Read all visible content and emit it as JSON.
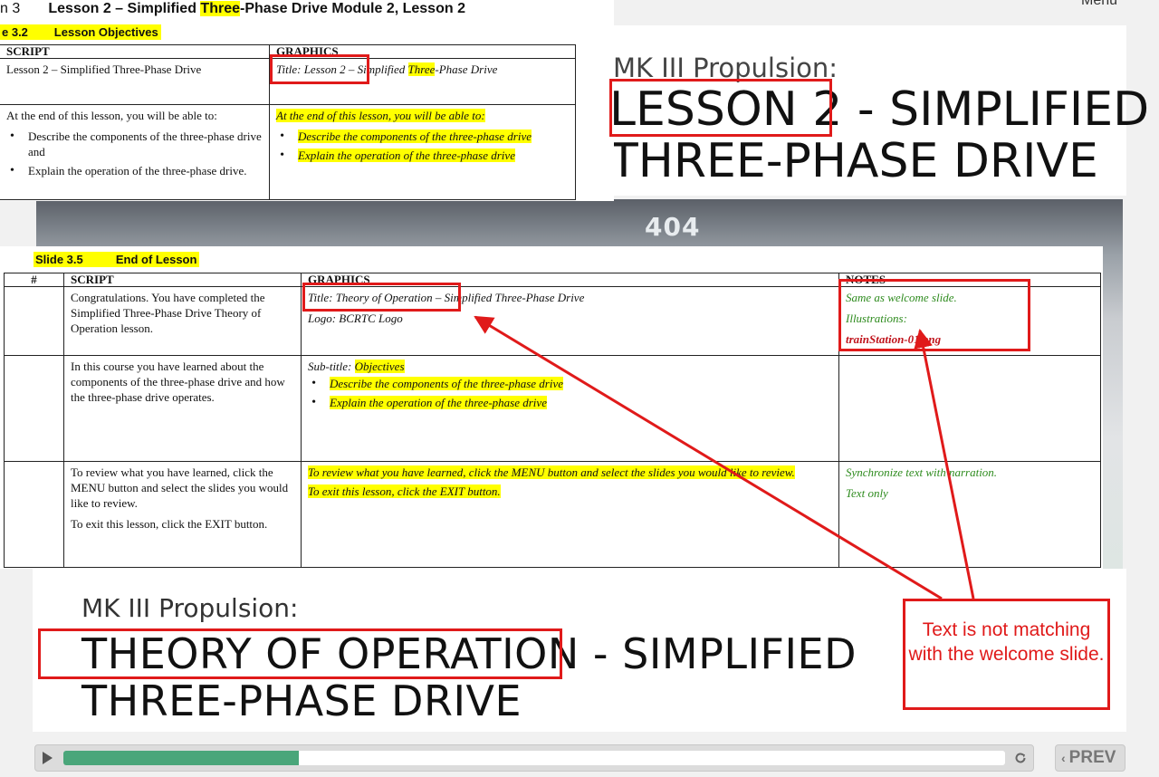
{
  "player": {
    "menu_label": "Menu",
    "train_number": "404",
    "bottom_slide": {
      "subtitle": "MK III Propulsion:",
      "title_boxed": "THEORY OF OPERATION",
      "title_rest": " - SIMPLIFIED",
      "title_line2": "THREE-PHASE DRIVE"
    },
    "top_slide": {
      "subtitle": "MK III Propulsion:",
      "title_boxed": "LESSON 2",
      "title_rest": " - SIMPLIFIED",
      "title_line2": "THREE-PHASE DRIVE"
    },
    "progress": 0.25,
    "prev_label": "PREV",
    "colors": {
      "progress": "#4aa67a",
      "annotation": "#e01a1a",
      "highlight": "#ffff00",
      "note_green": "#2e8b1e"
    }
  },
  "doc1": {
    "heading_num": "n 3",
    "heading_pre": "Lesson 2 – Simplified ",
    "heading_hl": "Three",
    "heading_post": "-Phase Drive Module 2, Lesson 2",
    "slide_label": "e 3.2        Lesson Objectives",
    "col_script": "SCRIPT",
    "col_graphics": "GRAPHICS",
    "row1_script": "Lesson 2 – Simplified Three-Phase Drive",
    "row1_graphics_boxed": "Title: Lesson 2 –",
    "row1_graphics_mid": " Simplified ",
    "row1_graphics_hl": "Three",
    "row1_graphics_post": "-Phase Drive",
    "row2_script_intro": "At the end of this lesson, you will be able to:",
    "row2_script_items": [
      "Describe the components of the three-phase drive and",
      "Explain the operation of the three-phase drive."
    ],
    "row2_graphics_intro": "At the end of this lesson, you will be able to:",
    "row2_graphics_items": [
      "Describe the components of the three-phase drive",
      "Explain the operation of the three-phase drive"
    ]
  },
  "doc2": {
    "slide_label": "Slide 3.5          End of Lesson",
    "col_num": "#",
    "col_script": "SCRIPT",
    "col_graphics": "GRAPHICS",
    "col_notes": "NOTES",
    "r1_script": "Congratulations. You have completed the Simplified Three-Phase Drive Theory of Operation lesson.",
    "r1_graphics_title": "Title: Theory of Operation – Simplified Three-Phase Drive",
    "r1_graphics_logo": "Logo: BCRTC Logo",
    "r1_notes_1": "Same as welcome slide.",
    "r1_notes_2": "Illustrations:",
    "r1_notes_3": "trainStation-01.png",
    "r2_script": "In this course you have learned about the components of the three-phase drive and how the three-phase drive operates.",
    "r2_graphics_sub_pre": "Sub-title: ",
    "r2_graphics_sub_hl": "Objectives",
    "r2_graphics_items": [
      "Describe the components of the three-phase drive",
      "Explain the operation of the three-phase drive"
    ],
    "r3_script_1": "To review what you have learned, click the MENU button and select the slides you would like to review.",
    "r3_script_2": "To exit this lesson, click the EXIT button.",
    "r3_graphics_1": "To review what you have learned, click the MENU button and select the slides you would like to review.",
    "r3_graphics_2": "To exit this lesson, click the EXIT button.",
    "r3_notes_1": "Synchronize text with narration.",
    "r3_notes_2": "Text only"
  },
  "callout": {
    "text": "Text is not matching with the welcome slide."
  }
}
